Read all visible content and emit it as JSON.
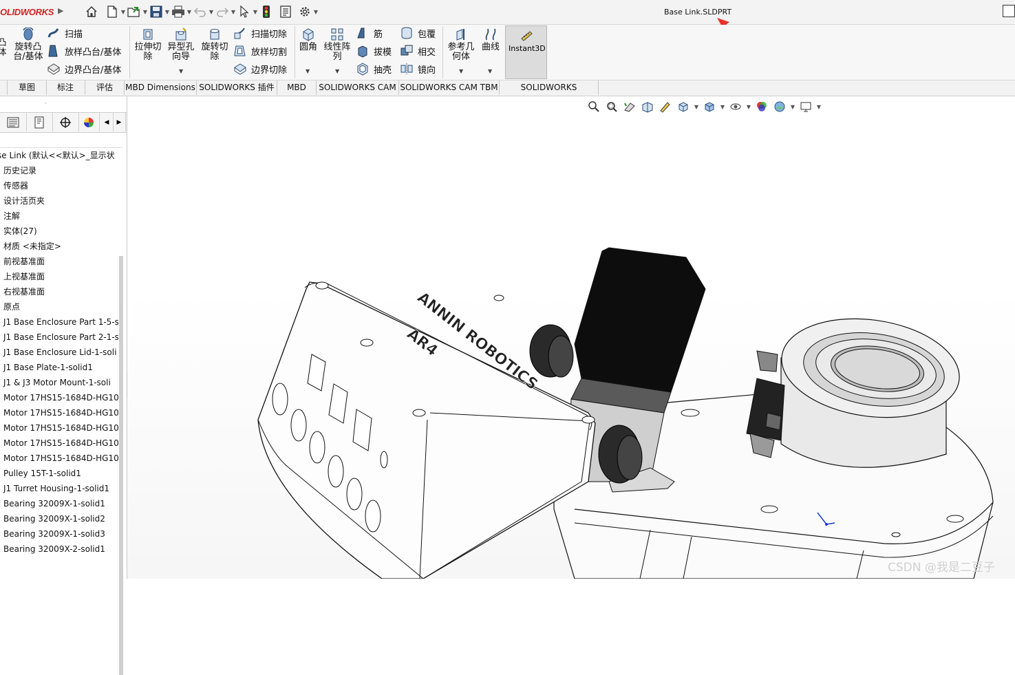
{
  "app": {
    "logo_text": "DS SOLIDWORKS",
    "logo_visible": "LIDWORKS",
    "logo_prefix": "O",
    "document_title": "Base Link.SLDPRT"
  },
  "quick_access": [
    "home-icon",
    "new-document-icon",
    "open-icon",
    "save-icon",
    "print-icon",
    "undo-icon",
    "redo-icon",
    "select-icon",
    "rebuild-icon",
    "file-properties-icon",
    "options-icon"
  ],
  "ribbon": {
    "partial_left_1": "凸",
    "partial_left_2": "体",
    "revolve_boss_1": "旋转凸",
    "revolve_boss_2": "台/基体",
    "sweep": "扫描",
    "loft_boss": "放样凸台/基体",
    "boundary_boss": "边界凸台/基体",
    "extrude_cut_1": "拉伸切",
    "extrude_cut_2": "除",
    "hole_wizard_1": "异型孔",
    "hole_wizard_2": "向导",
    "revolve_cut_1": "旋转切",
    "revolve_cut_2": "除",
    "swept_cut": "扫描切除",
    "lofted_cut": "放样切割",
    "boundary_cut": "边界切除",
    "fillet": "圆角",
    "linear_pattern_1": "线性阵",
    "linear_pattern_2": "列",
    "rib": "筋",
    "draft": "拔模",
    "shell": "抽壳",
    "wrap": "包覆",
    "intersect": "相交",
    "mirror": "镜向",
    "ref_geometry_1": "参考几",
    "ref_geometry_2": "何体",
    "curves": "曲线",
    "instant3d": "Instant3D"
  },
  "tabs": [
    "草图",
    "标注",
    "评估",
    "MBD Dimensions",
    "SOLIDWORKS 插件",
    "MBD",
    "SOLIDWORKS CAM",
    "SOLIDWORKS CAM TBM",
    "SOLIDWORKS Inspection"
  ],
  "feature_tree": {
    "root": "se Link  (默认<<默认>_显示状",
    "items": [
      "历史记录",
      "传感器",
      "设计活页夹",
      "注解",
      "实体(27)",
      "材质 <未指定>",
      "前视基准面",
      "上视基准面",
      "右视基准面",
      "原点",
      "J1 Base Enclosure Part 1-5-s",
      "J1 Base Enclosure Part 2-1-s",
      "J1 Base Enclosure Lid-1-soli",
      "J1 Base Plate-1-solid1",
      "J1 & J3 Motor Mount-1-soli",
      "Motor 17HS15-1684D-HG10",
      "Motor 17HS15-1684D-HG10",
      "Motor 17HS15-1684D-HG10",
      "Motor 17HS15-1684D-HG10",
      "Motor 17HS15-1684D-HG10",
      "Pulley 15T-1-solid1",
      "J1 Turret Housing-1-solid1",
      "Bearing 32009X-1-solid1",
      "Bearing 32009X-1-solid2",
      "Bearing 32009X-1-solid3",
      "Bearing 32009X-2-solid1"
    ]
  },
  "model_embossed_text": {
    "line1": "ANNIN ROBOTICS",
    "line2": "AR4"
  },
  "watermark": "CSDN @我是二豆子",
  "colors": {
    "brand_red": "#d11f24",
    "arrow_red": "#e8322d",
    "selected_button": "#dcdcdc"
  }
}
